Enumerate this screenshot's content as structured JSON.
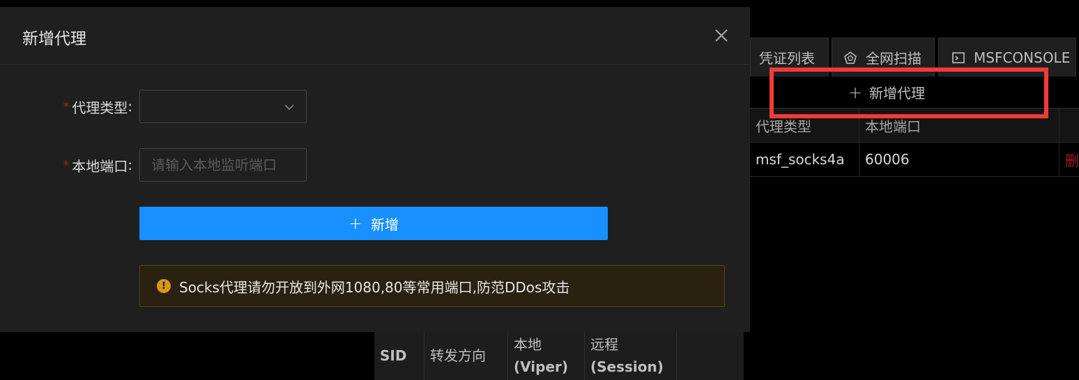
{
  "background": {
    "tabs": [
      {
        "label": "凭证列表",
        "icon": ""
      },
      {
        "label": "全网扫描",
        "icon": "pentagon-icon"
      },
      {
        "label": "MSFCONSOLE",
        "icon": "terminal-icon"
      }
    ],
    "add_proxy_label": "新增代理",
    "proxy_table": {
      "headers": [
        "代理类型",
        "本地端口"
      ],
      "rows": [
        {
          "type": "msf_socks4a",
          "port": "60006",
          "action": "删"
        }
      ]
    },
    "forward_table": {
      "headers": [
        {
          "line1": "SID",
          "line2": ""
        },
        {
          "line1": "转发方向",
          "line2": ""
        },
        {
          "line1": "本地",
          "line2": "(Viper)"
        },
        {
          "line1": "远程",
          "line2": "(Session)"
        }
      ]
    },
    "highlight_color": "#f23a3a"
  },
  "modal": {
    "title": "新增代理",
    "fields": {
      "proxy_type": {
        "label": "代理类型",
        "value": ""
      },
      "local_port": {
        "label": "本地端口",
        "placeholder": "请输入本地监听端口",
        "value": ""
      }
    },
    "submit_label": "新增",
    "alert": "Socks代理请勿开放到外网1080,80等常用端口,防范DDos攻击",
    "colors": {
      "primary": "#1890ff",
      "warning": "#d89614",
      "required": "#a61d24"
    }
  }
}
